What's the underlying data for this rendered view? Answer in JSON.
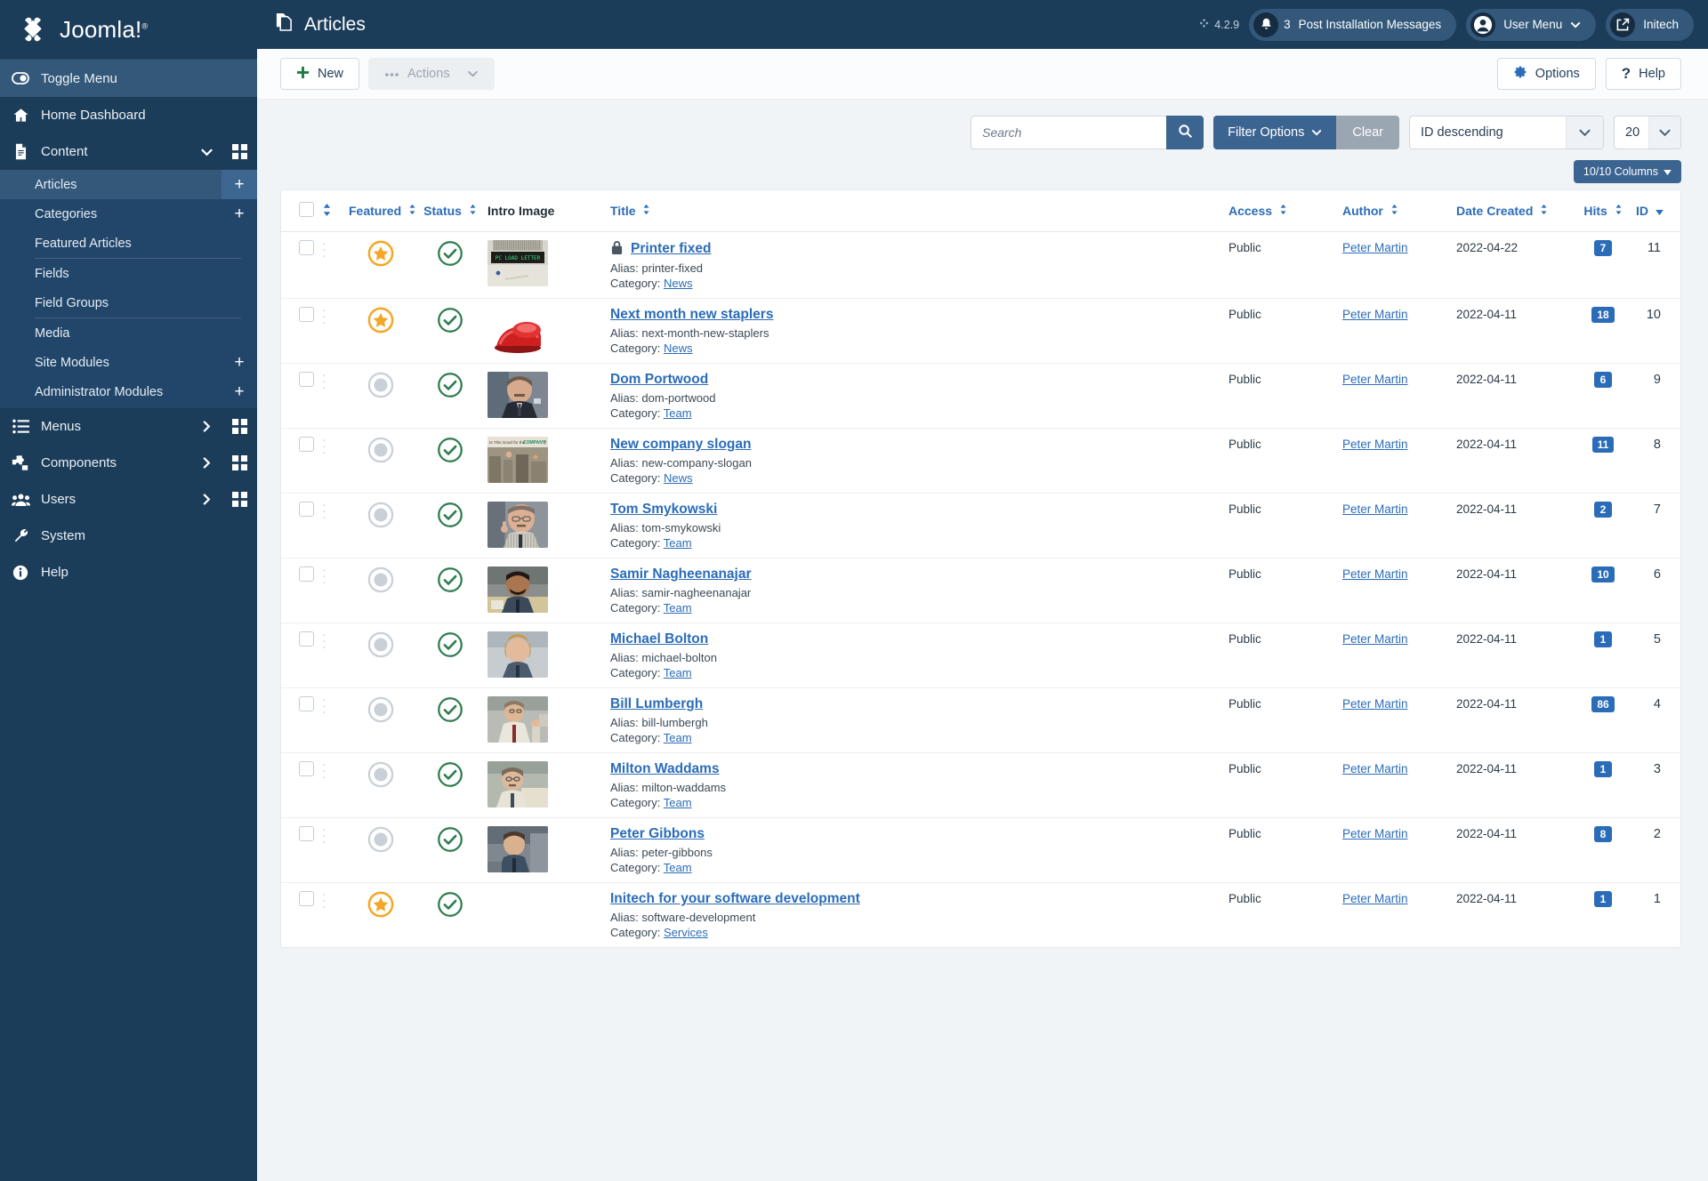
{
  "brand": {
    "name": "Joomla!",
    "registered": "®"
  },
  "sidebar": {
    "toggle_label": "Toggle Menu",
    "items": [
      {
        "label": "Home Dashboard",
        "icon": "home-icon"
      },
      {
        "label": "Content",
        "icon": "document-icon",
        "chevron": "chevron-down-icon",
        "grid": "grid-icon"
      },
      {
        "label": "Menus",
        "icon": "list-icon",
        "chevron": "chevron-right-icon",
        "grid": "grid-icon"
      },
      {
        "label": "Components",
        "icon": "puzzle-icon",
        "chevron": "chevron-right-icon",
        "grid": "grid-icon"
      },
      {
        "label": "Users",
        "icon": "users-icon",
        "chevron": "chevron-right-icon",
        "grid": "grid-icon"
      },
      {
        "label": "System",
        "icon": "wrench-icon"
      },
      {
        "label": "Help",
        "icon": "info-icon"
      }
    ],
    "content_sub": [
      {
        "label": "Articles",
        "plus": "+",
        "active": true
      },
      {
        "label": "Categories",
        "plus": "+",
        "active": false
      },
      {
        "label": "Featured Articles",
        "plus": "",
        "active": false
      },
      {
        "label": "Fields",
        "plus": "",
        "active": false
      },
      {
        "label": "Field Groups",
        "plus": "",
        "active": false
      },
      {
        "label": "Media",
        "plus": "",
        "active": false
      },
      {
        "label": "Site Modules",
        "plus": "+",
        "active": false
      },
      {
        "label": "Administrator Modules",
        "plus": "+",
        "active": false
      }
    ]
  },
  "header": {
    "title": "Articles",
    "title_icon": "articles-icon",
    "version": "4.2.9",
    "version_icon": "joomla-mark-icon",
    "notifications": {
      "count": "3",
      "label": "Post Installation Messages",
      "icon": "bell-icon"
    },
    "user_menu": {
      "label": "User Menu",
      "icon": "user-circle-icon",
      "chevron": "chevron-down-icon"
    },
    "site": {
      "label": "Initech",
      "icon": "external-link-icon"
    }
  },
  "toolbar": {
    "new_label": "New",
    "new_icon": "plus-icon",
    "actions_label": "Actions",
    "actions_icon": "ellipsis-icon",
    "actions_chevron": "chevron-down-icon",
    "options_label": "Options",
    "options_icon": "gear-icon",
    "help_label": "Help",
    "help_icon": "question-icon"
  },
  "filters": {
    "search_placeholder": "Search",
    "search_value": "",
    "search_icon": "search-icon",
    "filter_options_label": "Filter Options",
    "filter_chevron": "chevron-down-icon",
    "clear_label": "Clear",
    "sort_value": "ID descending",
    "limit_value": "20",
    "columns_label": "10/10 Columns"
  },
  "table": {
    "headers": {
      "checkbox": "",
      "ordering": "",
      "featured": "Featured",
      "status": "Status",
      "intro_image": "Intro Image",
      "title": "Title",
      "access": "Access",
      "author": "Author",
      "date_created": "Date Created",
      "hits": "Hits",
      "id": "ID"
    },
    "rows": [
      {
        "featured": true,
        "status": "published",
        "locked": true,
        "title": "Printer fixed",
        "alias": "Alias: printer-fixed",
        "category_label": "Category:",
        "category": "News",
        "access": "Public",
        "author": "Peter Martin",
        "date": "2022-04-22",
        "hits": "7",
        "id": "11",
        "img": "printer"
      },
      {
        "featured": true,
        "status": "published",
        "locked": false,
        "title": "Next month new staplers",
        "alias": "Alias: next-month-new-staplers",
        "category_label": "Category:",
        "category": "News",
        "access": "Public",
        "author": "Peter Martin",
        "date": "2022-04-11",
        "hits": "18",
        "id": "10",
        "img": "stapler"
      },
      {
        "featured": false,
        "status": "published",
        "locked": false,
        "title": "Dom Portwood",
        "alias": "Alias: dom-portwood",
        "category_label": "Category:",
        "category": "Team",
        "access": "Public",
        "author": "Peter Martin",
        "date": "2022-04-11",
        "hits": "6",
        "id": "9",
        "img": "dom"
      },
      {
        "featured": false,
        "status": "published",
        "locked": false,
        "title": "New company slogan",
        "alias": "Alias: new-company-slogan",
        "category_label": "Category:",
        "category": "News",
        "access": "Public",
        "author": "Peter Martin",
        "date": "2022-04-11",
        "hits": "11",
        "id": "8",
        "img": "slogan"
      },
      {
        "featured": false,
        "status": "published",
        "locked": false,
        "title": "Tom Smykowski",
        "alias": "Alias: tom-smykowski",
        "category_label": "Category:",
        "category": "Team",
        "access": "Public",
        "author": "Peter Martin",
        "date": "2022-04-11",
        "hits": "2",
        "id": "7",
        "img": "tom"
      },
      {
        "featured": false,
        "status": "published",
        "locked": false,
        "title": "Samir Nagheenanajar",
        "alias": "Alias: samir-nagheenanajar",
        "category_label": "Category:",
        "category": "Team",
        "access": "Public",
        "author": "Peter Martin",
        "date": "2022-04-11",
        "hits": "10",
        "id": "6",
        "img": "samir"
      },
      {
        "featured": false,
        "status": "published",
        "locked": false,
        "title": "Michael Bolton",
        "alias": "Alias: michael-bolton",
        "category_label": "Category:",
        "category": "Team",
        "access": "Public",
        "author": "Peter Martin",
        "date": "2022-04-11",
        "hits": "1",
        "id": "5",
        "img": "michael"
      },
      {
        "featured": false,
        "status": "published",
        "locked": false,
        "title": "Bill Lumbergh",
        "alias": "Alias: bill-lumbergh",
        "category_label": "Category:",
        "category": "Team",
        "access": "Public",
        "author": "Peter Martin",
        "date": "2022-04-11",
        "hits": "86",
        "id": "4",
        "img": "bill"
      },
      {
        "featured": false,
        "status": "published",
        "locked": false,
        "title": "Milton Waddams",
        "alias": "Alias: milton-waddams",
        "category_label": "Category:",
        "category": "Team",
        "access": "Public",
        "author": "Peter Martin",
        "date": "2022-04-11",
        "hits": "1",
        "id": "3",
        "img": "milton"
      },
      {
        "featured": false,
        "status": "published",
        "locked": false,
        "title": "Peter Gibbons",
        "alias": "Alias: peter-gibbons",
        "category_label": "Category:",
        "category": "Team",
        "access": "Public",
        "author": "Peter Martin",
        "date": "2022-04-11",
        "hits": "8",
        "id": "2",
        "img": "peter"
      },
      {
        "featured": true,
        "status": "published",
        "locked": false,
        "title": "Initech for your software development",
        "alias": "Alias: software-development",
        "category_label": "Category:",
        "category": "Services",
        "access": "Public",
        "author": "Peter Martin",
        "date": "2022-04-11",
        "hits": "1",
        "id": "1",
        "img": "none"
      }
    ]
  },
  "colors": {
    "sidebar_bg": "#1c3d5a",
    "accent_blue": "#2b6cb8",
    "featured_gold": "#f5a623",
    "published_green": "#2e7d4f",
    "badge_blue": "#2b6cb8"
  }
}
